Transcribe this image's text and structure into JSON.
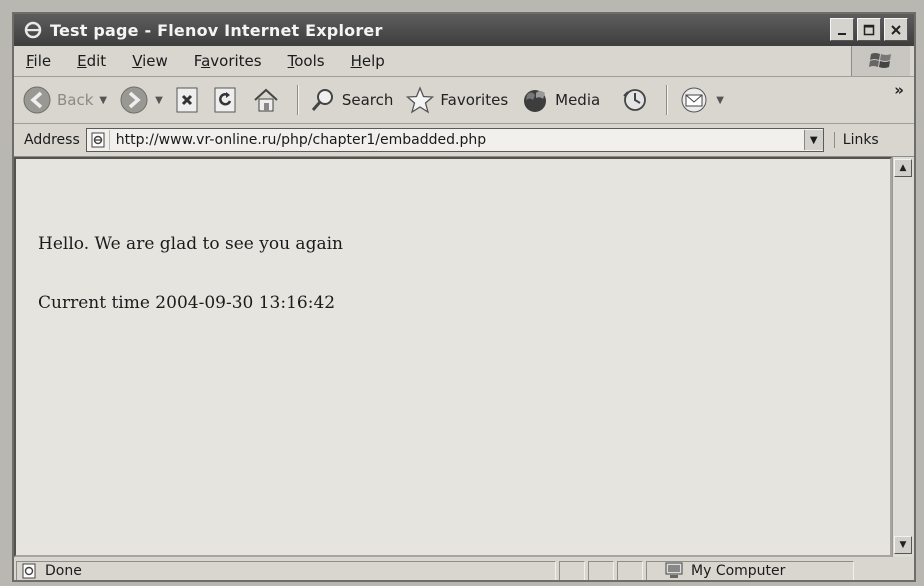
{
  "window": {
    "title": "Test page - Flenov Internet Explorer"
  },
  "menu": [
    {
      "pre": "",
      "u": "F",
      "post": "ile"
    },
    {
      "pre": "",
      "u": "E",
      "post": "dit"
    },
    {
      "pre": "",
      "u": "V",
      "post": "iew"
    },
    {
      "pre": "F",
      "u": "a",
      "post": "vorites"
    },
    {
      "pre": "",
      "u": "T",
      "post": "ools"
    },
    {
      "pre": "",
      "u": "H",
      "post": "elp"
    }
  ],
  "toolbar": {
    "back_label": "Back",
    "search_label": "Search",
    "favorites_label": "Favorites",
    "media_label": "Media",
    "more": "»"
  },
  "address": {
    "label": "Address",
    "url": "http://www.vr-online.ru/php/chapter1/embadded.php",
    "links_label": "Links"
  },
  "content": {
    "greeting": "Hello.  We are glad to see you again",
    "time_line": "Current time 2004-09-30 13:16:42"
  },
  "status": {
    "text": "Done",
    "zone": "My Computer"
  }
}
